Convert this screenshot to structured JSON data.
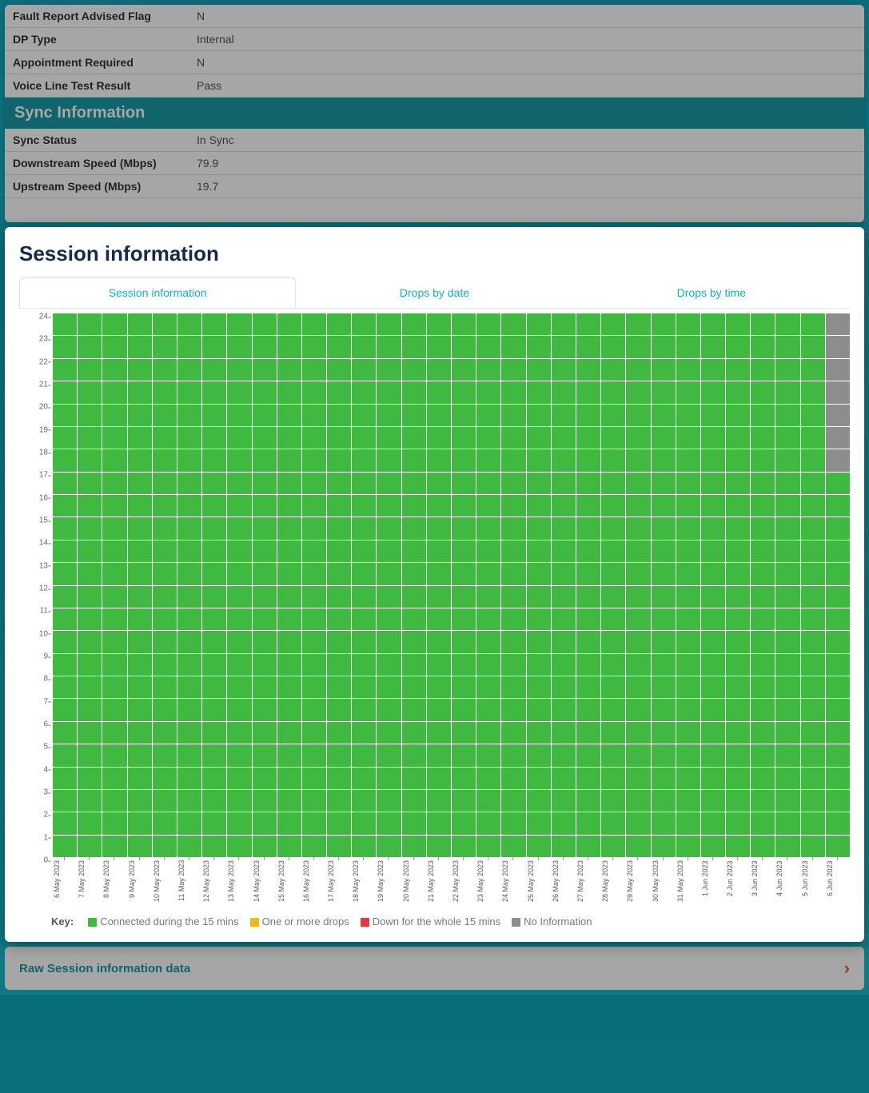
{
  "top_info": {
    "rows": [
      {
        "label": "Fault Report Advised Flag",
        "value": "N"
      },
      {
        "label": "DP Type",
        "value": "Internal"
      },
      {
        "label": "Appointment Required",
        "value": "N"
      },
      {
        "label": "Voice Line Test Result",
        "value": "Pass"
      }
    ]
  },
  "sync": {
    "header": "Sync Information",
    "rows": [
      {
        "label": "Sync Status",
        "value": "In Sync"
      },
      {
        "label": "Downstream Speed (Mbps)",
        "value": "79.9"
      },
      {
        "label": "Upstream Speed (Mbps)",
        "value": "19.7"
      }
    ]
  },
  "session": {
    "title": "Session information",
    "tabs": [
      "Session information",
      "Drops by date",
      "Drops by time"
    ],
    "legend_key": "Key:",
    "legend": [
      {
        "color": "green",
        "label": "Connected during the 15 mins"
      },
      {
        "color": "yellow",
        "label": "One or more drops"
      },
      {
        "color": "red",
        "label": "Down for the whole 15 mins"
      },
      {
        "color": "grey",
        "label": "No Information"
      }
    ]
  },
  "raw_bar": "Raw Session information data",
  "chart_data": {
    "type": "heatmap",
    "title": "Session information",
    "xlabel": "",
    "ylabel": "",
    "ylim": [
      0,
      24
    ],
    "y_ticks": [
      0,
      1,
      2,
      3,
      4,
      5,
      6,
      7,
      8,
      9,
      10,
      11,
      12,
      13,
      14,
      15,
      16,
      17,
      18,
      19,
      20,
      21,
      22,
      23,
      24
    ],
    "categories": [
      "6 May 2023",
      "7 May 2023",
      "8 May 2023",
      "9 May 2023",
      "10 May 2023",
      "11 May 2023",
      "12 May 2023",
      "13 May 2023",
      "14 May 2023",
      "15 May 2023",
      "16 May 2023",
      "17 May 2023",
      "18 May 2023",
      "19 May 2023",
      "20 May 2023",
      "21 May 2023",
      "22 May 2023",
      "23 May 2023",
      "24 May 2023",
      "25 May 2023",
      "26 May 2023",
      "27 May 2023",
      "28 May 2023",
      "29 May 2023",
      "30 May 2023",
      "31 May 2023",
      "1 Jun 2023",
      "2 Jun 2023",
      "3 Jun 2023",
      "4 Jun 2023",
      "5 Jun 2023",
      "6 Jun 2023"
    ],
    "values_note": "Each day column has 24 hourly cells. 'connected' everywhere except last day hours 17-24 = 'noinfo'.",
    "last_day_noinfo_from_hour": 17,
    "status_palette": {
      "connected": "#3fb93f",
      "drop": "#f3b61f",
      "down": "#e23b3b",
      "noinfo": "#8d8d8d"
    }
  }
}
